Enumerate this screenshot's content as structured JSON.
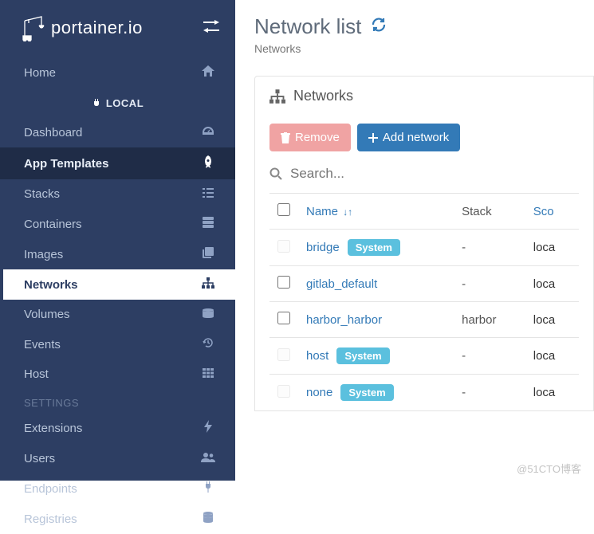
{
  "brand": "portainer.io",
  "endpoint_label": "LOCAL",
  "nav": {
    "home": "Home",
    "dashboard": "Dashboard",
    "app_templates": "App Templates",
    "stacks": "Stacks",
    "containers": "Containers",
    "images": "Images",
    "networks": "Networks",
    "volumes": "Volumes",
    "events": "Events",
    "host": "Host",
    "settings_heading": "SETTINGS",
    "extensions": "Extensions",
    "users": "Users",
    "endpoints": "Endpoints",
    "registries": "Registries"
  },
  "page": {
    "title": "Network list",
    "breadcrumb": "Networks"
  },
  "panel": {
    "title": "Networks",
    "remove_label": "Remove",
    "add_label": "Add network",
    "search_placeholder": "Search..."
  },
  "columns": {
    "name": "Name",
    "stack": "Stack",
    "scope": "Sco"
  },
  "rows": [
    {
      "name": "bridge",
      "system": true,
      "locked": true,
      "stack": "-",
      "scope": "loca"
    },
    {
      "name": "gitlab_default",
      "system": false,
      "locked": false,
      "stack": "-",
      "scope": "loca"
    },
    {
      "name": "harbor_harbor",
      "system": false,
      "locked": false,
      "stack": "harbor",
      "scope": "loca"
    },
    {
      "name": "host",
      "system": true,
      "locked": true,
      "stack": "-",
      "scope": "loca"
    },
    {
      "name": "none",
      "system": true,
      "locked": true,
      "stack": "-",
      "scope": "loca"
    }
  ],
  "system_tag": "System",
  "watermark": "@51CTO博客"
}
